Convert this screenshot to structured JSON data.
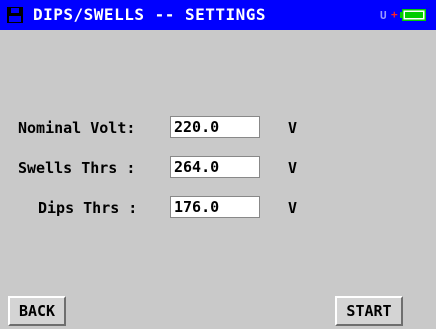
{
  "header": {
    "title": "DIPS/SWELLS -- SETTINGS",
    "indicator_text": "U",
    "indicator_plus": "+",
    "app_icon": "floppy-disk-icon",
    "battery_icon": "battery-icon",
    "battery_color": "#00cc00"
  },
  "colors": {
    "titlebar": "#0000ff",
    "background": "#c9c9c9"
  },
  "form": {
    "nominal": {
      "label": "Nominal Volt:",
      "value": "220.0",
      "unit": "V"
    },
    "swells": {
      "label": "Swells Thrs :",
      "value": "264.0",
      "unit": "V"
    },
    "dips": {
      "label": "Dips Thrs :",
      "value": "176.0",
      "unit": "V"
    }
  },
  "buttons": {
    "back": "BACK",
    "start": "START"
  }
}
